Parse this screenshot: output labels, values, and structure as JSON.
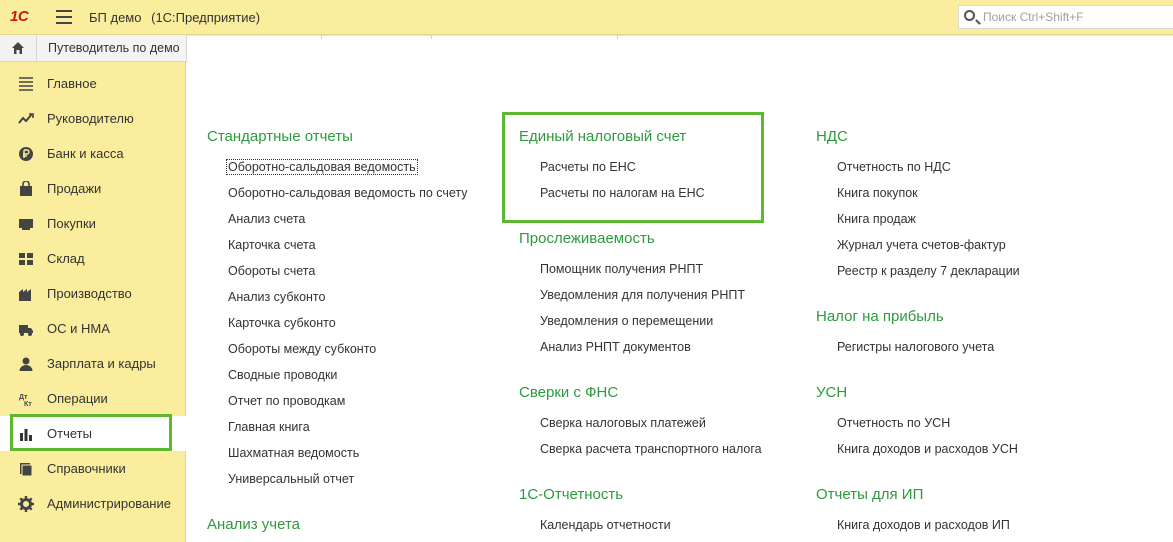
{
  "app": {
    "logo": "1С",
    "title": "БП демо",
    "subtitle": "(1С:Предприятие)",
    "search_placeholder": "Поиск Ctrl+Shift+F"
  },
  "tab": {
    "label": "Путеводитель по демо"
  },
  "sidebar": {
    "items": [
      {
        "label": "Главное",
        "icon": "menu-list-icon"
      },
      {
        "label": "Руководителю",
        "icon": "trend-icon"
      },
      {
        "label": "Банк и касса",
        "icon": "ruble-coin-icon"
      },
      {
        "label": "Продажи",
        "icon": "shopping-bag-icon"
      },
      {
        "label": "Покупки",
        "icon": "cart-icon"
      },
      {
        "label": "Склад",
        "icon": "warehouse-icon"
      },
      {
        "label": "Производство",
        "icon": "factory-icon"
      },
      {
        "label": "ОС и НМА",
        "icon": "truck-icon"
      },
      {
        "label": "Зарплата и кадры",
        "icon": "person-icon"
      },
      {
        "label": "Операции",
        "icon": "debit-credit-icon"
      },
      {
        "label": "Отчеты",
        "icon": "bar-chart-icon"
      },
      {
        "label": "Справочники",
        "icon": "books-icon"
      },
      {
        "label": "Администрирование",
        "icon": "gear-icon"
      }
    ],
    "active_index": 10
  },
  "columns": {
    "col1": {
      "sections": [
        {
          "title": "Стандартные отчеты",
          "links": [
            "Оборотно-сальдовая ведомость",
            "Оборотно-сальдовая ведомость по счету",
            "Анализ счета",
            "Карточка счета",
            "Обороты счета",
            "Анализ субконто",
            "Карточка субконто",
            "Обороты между субконто",
            "Сводные проводки",
            "Отчет по проводкам",
            "Главная книга",
            "Шахматная ведомость",
            "Универсальный отчет"
          ]
        },
        {
          "title": "Анализ учета",
          "links": []
        }
      ]
    },
    "col2": {
      "sections": [
        {
          "title": "Единый налоговый счет",
          "links": [
            "Расчеты по ЕНС",
            "Расчеты по налогам на ЕНС"
          ]
        },
        {
          "title": "Прослеживаемость",
          "links": [
            "Помощник получения РНПТ",
            "Уведомления для получения РНПТ",
            "Уведомления о перемещении",
            "Анализ РНПТ документов"
          ]
        },
        {
          "title": "Сверки с ФНС",
          "links": [
            "Сверка налоговых платежей",
            "Сверка расчета транспортного налога"
          ]
        },
        {
          "title": "1С-Отчетность",
          "links": [
            "Календарь отчетности"
          ]
        }
      ]
    },
    "col3": {
      "sections": [
        {
          "title": "НДС",
          "links": [
            "Отчетность по НДС",
            "Книга покупок",
            "Книга продаж",
            "Журнал учета счетов-фактур",
            "Реестр к разделу 7 декларации"
          ]
        },
        {
          "title": "Налог на прибыль",
          "links": [
            "Регистры налогового учета"
          ]
        },
        {
          "title": "УСН",
          "links": [
            "Отчетность по УСН",
            "Книга доходов и расходов УСН"
          ]
        },
        {
          "title": "Отчеты для ИП",
          "links": [
            "Книга доходов и расходов ИП"
          ]
        }
      ]
    }
  },
  "colors": {
    "accent_green": "#2e9a3e",
    "highlight": "#5cb82f",
    "panel": "#fbed9e"
  }
}
